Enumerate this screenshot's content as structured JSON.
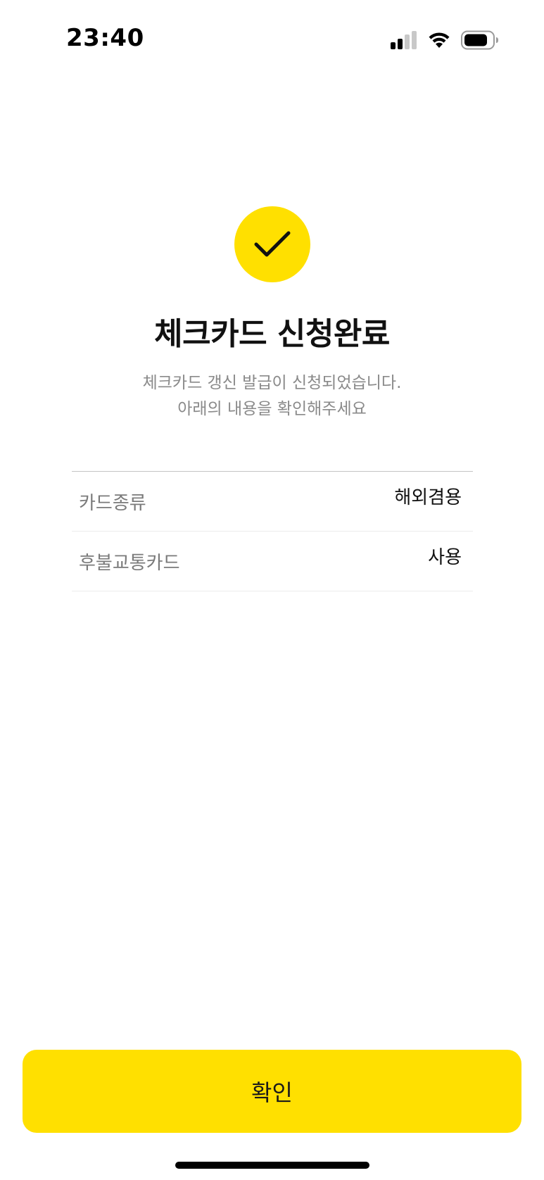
{
  "status_bar": {
    "time": "23:40",
    "icons": [
      "cellular-signal-icon",
      "wifi-icon",
      "battery-icon"
    ]
  },
  "result": {
    "icon": "check-icon",
    "title": "체크카드 신청완료",
    "subtitle_line1": "체크카드 갱신 발급이 신청되었습니다.",
    "subtitle_line2": "아래의 내용을 확인해주세요"
  },
  "details": [
    {
      "label": "카드종류",
      "value": "해외겸용"
    },
    {
      "label": "후불교통카드",
      "value": "사용"
    }
  ],
  "confirm_label": "확인",
  "colors": {
    "accent": "#FFE000",
    "text_primary": "#111111",
    "text_secondary": "#8a8a8a"
  }
}
